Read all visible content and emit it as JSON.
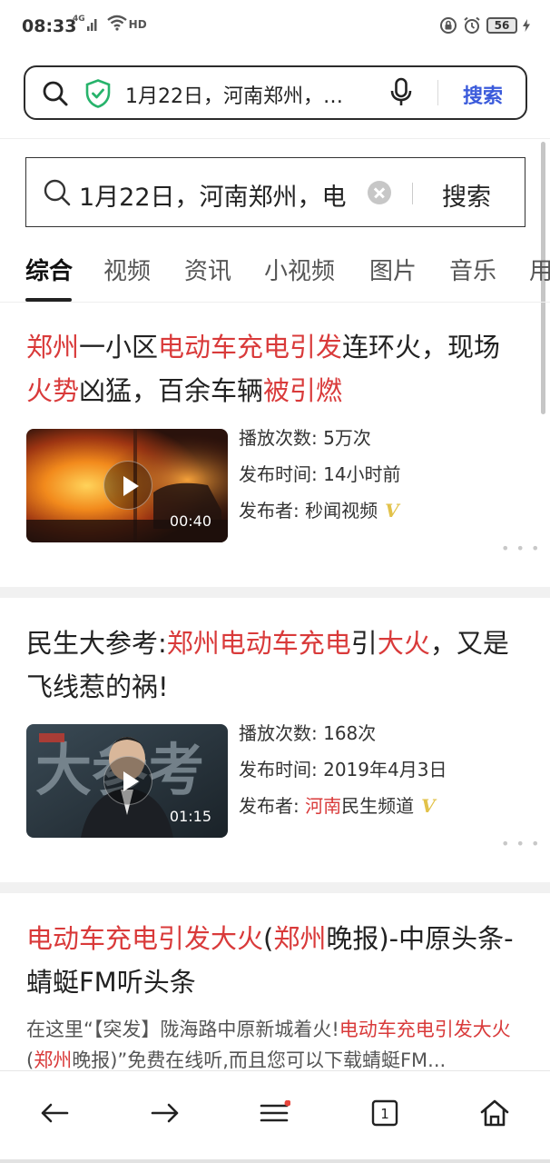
{
  "status_bar": {
    "time": "08:33",
    "network": "4G",
    "hd": "HD",
    "battery": "56"
  },
  "browser": {
    "url_text": "1月22日，河南郑州，…",
    "search_label": "搜索",
    "accent": "#3b5bdb",
    "shield_color": "#27b36b"
  },
  "page_search": {
    "query": "1月22日，河南郑州，电",
    "button_label": "搜索"
  },
  "tabs": [
    {
      "label": "综合",
      "active": true
    },
    {
      "label": "视频"
    },
    {
      "label": "资讯"
    },
    {
      "label": "小视频"
    },
    {
      "label": "图片"
    },
    {
      "label": "音乐"
    },
    {
      "label": "用"
    }
  ],
  "highlight_color": "#d93a3a",
  "results": [
    {
      "title_parts": [
        {
          "t": "郑州",
          "hl": true
        },
        {
          "t": "一小区"
        },
        {
          "t": "电动车充电引发",
          "hl": true
        },
        {
          "t": "连环火，现场"
        },
        {
          "t": "火势",
          "hl": true
        },
        {
          "t": "凶猛，百余车辆"
        },
        {
          "t": "被引燃",
          "hl": true
        }
      ],
      "duration": "00:40",
      "plays_label": "播放次数:",
      "plays": "5万次",
      "time_label": "发布时间:",
      "time": "14小时前",
      "publisher_label": "发布者:",
      "publisher": "秒闻视频",
      "verified": "V"
    },
    {
      "title_parts": [
        {
          "t": "民生大参考:"
        },
        {
          "t": "郑州电动车充电",
          "hl": true
        },
        {
          "t": "引"
        },
        {
          "t": "大火",
          "hl": true
        },
        {
          "t": "，又是飞线惹的祸!"
        }
      ],
      "duration": "01:15",
      "plays_label": "播放次数:",
      "plays": "168次",
      "time_label": "发布时间:",
      "time": "2019年4月3日",
      "publisher_label": "发布者:",
      "publisher_hl": "河南",
      "publisher_rest": "民生频道",
      "verified": "V"
    },
    {
      "title_parts": [
        {
          "t": "电动车充电引发大火",
          "hl": true
        },
        {
          "t": "("
        },
        {
          "t": "郑州",
          "hl": true
        },
        {
          "t": "晚报)-中原头条-蜻蜓FM听头条"
        }
      ],
      "snippet_parts": [
        {
          "t": "在这里“【突发】陇海路中原新城着火!"
        },
        {
          "t": "电动车充电引发大火",
          "hl": true
        },
        {
          "t": "("
        },
        {
          "t": "郑州",
          "hl": true
        },
        {
          "t": "晚报)”免费在线听,而且您可以下载蜻蜓FM..."
        }
      ]
    }
  ],
  "more_dots": "• • •",
  "bottom_nav": {
    "tab_count": "1",
    "notification_color": "#e8453c"
  }
}
